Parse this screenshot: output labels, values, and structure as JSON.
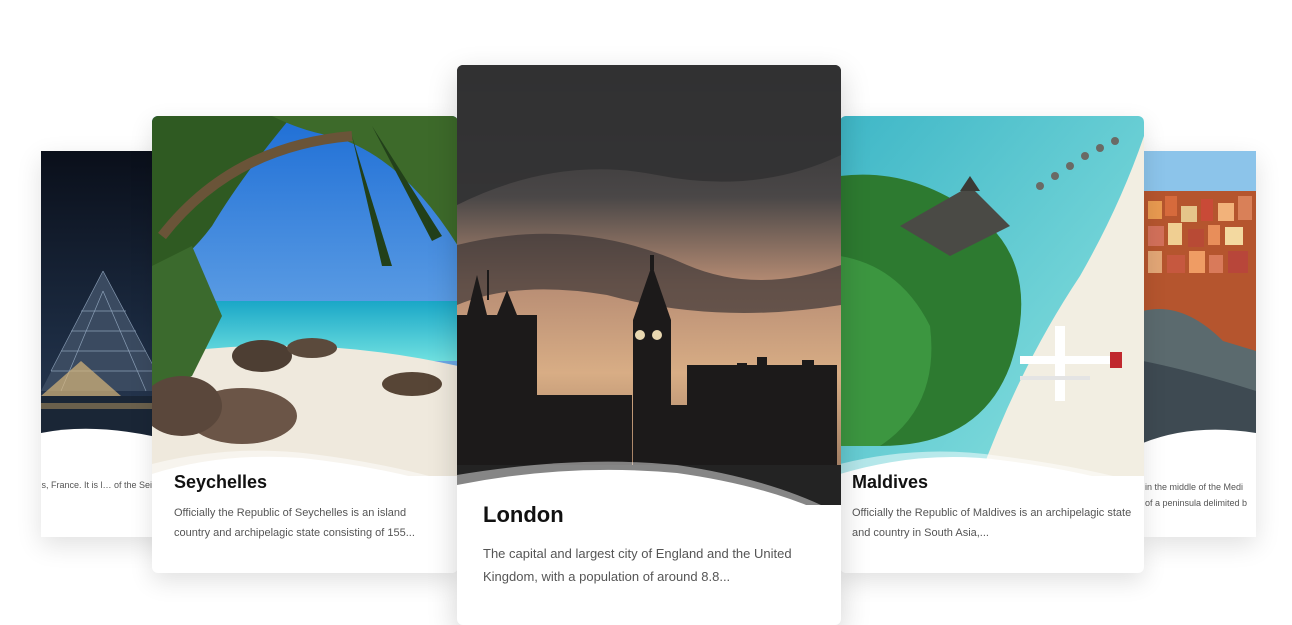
{
  "carousel": {
    "cards": [
      {
        "id": "paris",
        "title": "",
        "description": "um in Paris, France. It is l… of the Seine in the city's"
      },
      {
        "id": "seychelles",
        "title": "Seychelles",
        "description": "Officially the Republic of Seychelles is an island country and archipelagic state consisting of 155..."
      },
      {
        "id": "london",
        "title": "London",
        "description": "The capital and largest city of England and the United Kingdom, with a population of around 8.8..."
      },
      {
        "id": "maldives",
        "title": "Maldives",
        "description": "Officially the Republic of Maldives is an archipelagic state and country in South Asia,..."
      },
      {
        "id": "italy",
        "title": "",
        "description_line1": "in the middle of the Medi",
        "description_line2": "of a peninsula delimited b"
      }
    ]
  },
  "colors": {
    "card_background": "#ffffff",
    "title_text": "#111111",
    "body_text": "#555555"
  }
}
